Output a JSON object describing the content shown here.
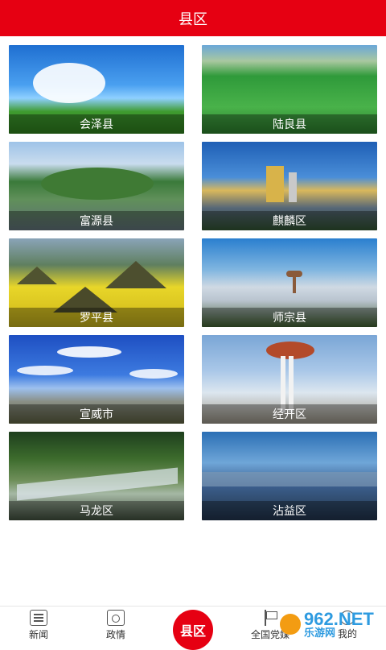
{
  "header": {
    "title": "县区"
  },
  "counties": [
    {
      "name": "会泽县"
    },
    {
      "name": "陆良县"
    },
    {
      "name": "富源县"
    },
    {
      "name": "麒麟区"
    },
    {
      "name": "罗平县"
    },
    {
      "name": "师宗县"
    },
    {
      "name": "宣威市"
    },
    {
      "name": "经开区"
    },
    {
      "name": "马龙区"
    },
    {
      "name": "沾益区"
    }
  ],
  "tabbar": {
    "items": [
      {
        "label": "新闻",
        "icon": "news-icon"
      },
      {
        "label": "政情",
        "icon": "government-icon"
      },
      {
        "label": "县区",
        "icon": "county-icon"
      },
      {
        "label": "全国党媒",
        "icon": "flag-icon"
      },
      {
        "label": "我的",
        "icon": "user-icon"
      }
    ],
    "center_label": "县区",
    "accent": "#e60012"
  },
  "watermark": {
    "logo": "962",
    "brand": "NET",
    "subtitle": "乐游网"
  }
}
